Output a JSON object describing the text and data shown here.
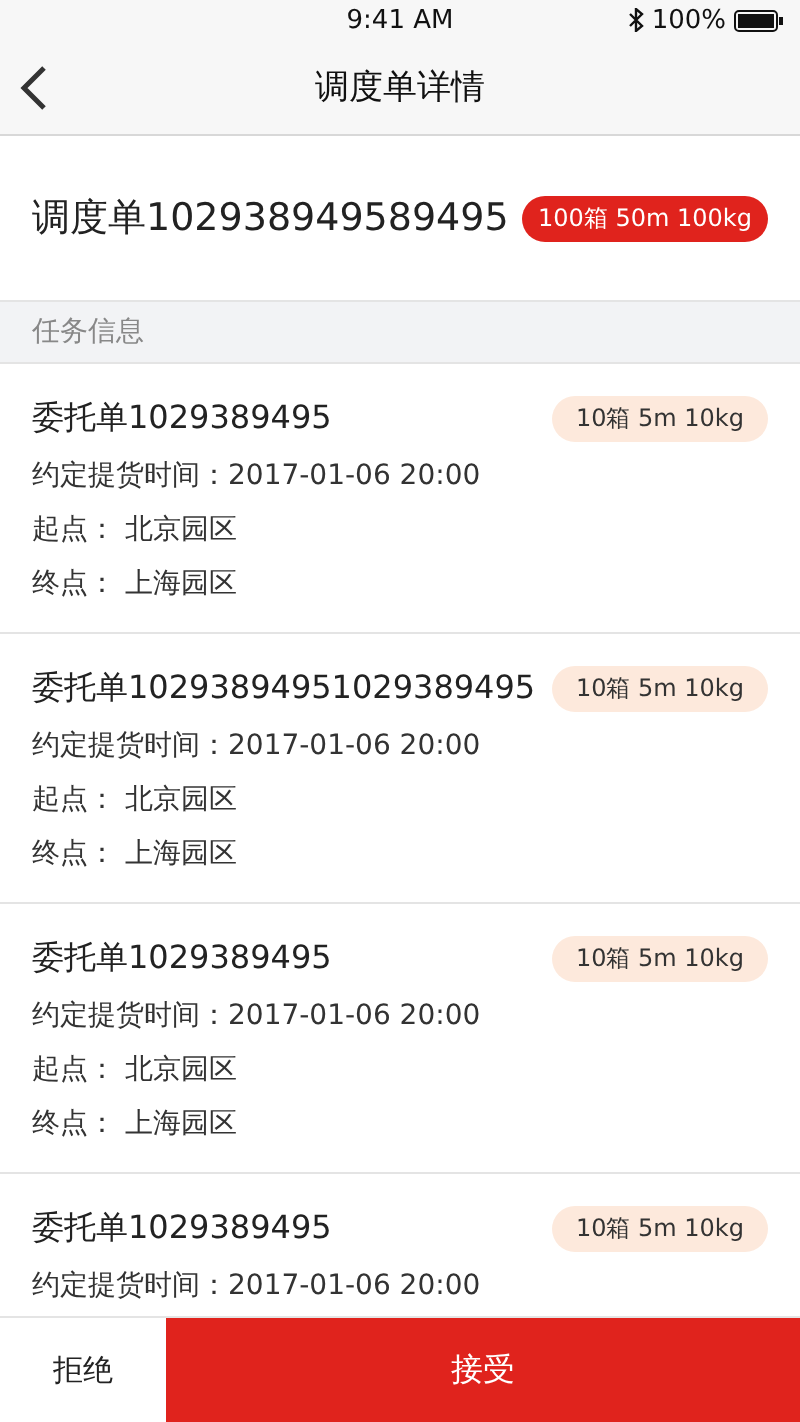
{
  "status_bar": {
    "time": "9:41 AM",
    "battery": "100%"
  },
  "nav": {
    "title": "调度单详情"
  },
  "dispatch": {
    "title": "调度单102938949589495",
    "badge": "100箱 50m 100kg"
  },
  "section_title": "任务信息",
  "orders": [
    {
      "title": "委托单1029389495",
      "badge": "10箱 5m 10kg",
      "pickup": "约定提货时间：2017-01-06 20:00",
      "start": "起点： 北京园区",
      "end": "终点： 上海园区"
    },
    {
      "title": "委托单10293894951029389495",
      "badge": "10箱 5m 10kg",
      "pickup": "约定提货时间：2017-01-06 20:00",
      "start": "起点： 北京园区",
      "end": "终点： 上海园区"
    },
    {
      "title": "委托单1029389495",
      "badge": "10箱 5m 10kg",
      "pickup": "约定提货时间：2017-01-06 20:00",
      "start": "起点： 北京园区",
      "end": "终点： 上海园区"
    },
    {
      "title": "委托单1029389495",
      "badge": "10箱 5m 10kg",
      "pickup": "约定提货时间：2017-01-06 20:00"
    }
  ],
  "buttons": {
    "reject": "拒绝",
    "accept": "接受"
  }
}
